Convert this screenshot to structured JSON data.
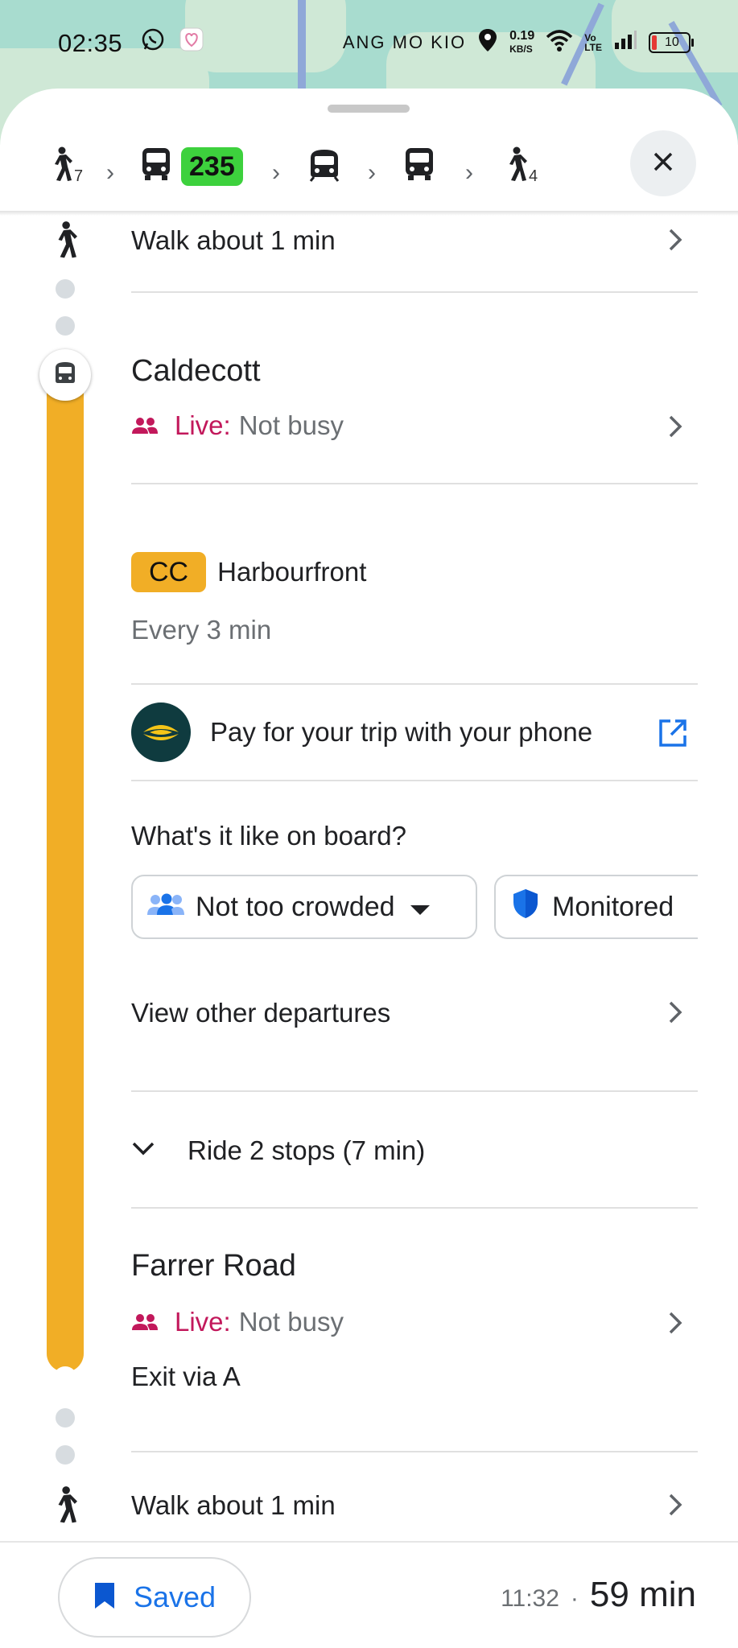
{
  "status_bar": {
    "time": "02:35",
    "carrier": "ANG MO KIO",
    "net_speed_value": "0.19",
    "net_speed_unit": "KB/S",
    "battery": "10"
  },
  "route_summary": {
    "walk_start_minutes": "7",
    "bus_number": "235",
    "walk_end_minutes": "4"
  },
  "walk_top": {
    "label": "Walk about 1 min"
  },
  "station_caldecott": {
    "name": "Caldecott",
    "live_label": "Live:",
    "live_status": "Not busy"
  },
  "line_info": {
    "line_code": "CC",
    "direction": "Harbourfront",
    "frequency": "Every 3 min"
  },
  "pay": {
    "label": "Pay for your trip with your phone"
  },
  "onboard": {
    "question": "What's it like on board?",
    "crowd_option": "Not too crowded",
    "security_option": "Monitored"
  },
  "departures": {
    "label": "View other departures"
  },
  "ride": {
    "label": "Ride 2 stops (7 min)"
  },
  "station_farrer": {
    "name": "Farrer Road",
    "live_label": "Live:",
    "live_status": "Not busy",
    "exit": "Exit via A"
  },
  "walk_bottom": {
    "label": "Walk about 1 min"
  },
  "bottom": {
    "saved_label": "Saved",
    "arrival_time": "11:32",
    "separator": "·",
    "duration": "59 min"
  },
  "colors": {
    "line_color": "#f1ae26",
    "live_color": "#c2185b",
    "accent_blue": "#1a73e8",
    "bus_badge": "#3dd13d"
  }
}
